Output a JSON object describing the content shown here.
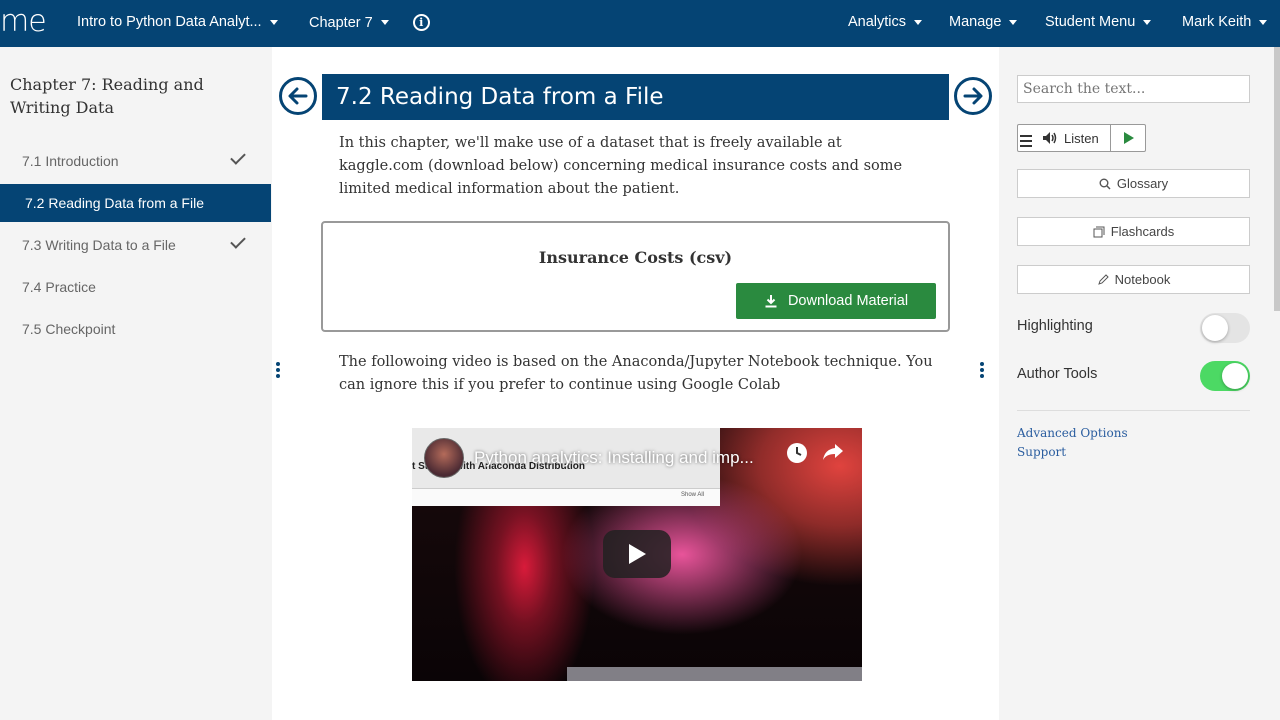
{
  "topbar": {
    "logo": "me",
    "course": "Intro to Python Data Analyt...",
    "chapter_menu": "Chapter 7",
    "analytics": "Analytics",
    "manage": "Manage",
    "student_menu": "Student Menu",
    "user": "Mark Keith"
  },
  "sidebar": {
    "chapter_title": "Chapter 7: Reading and Writing Data",
    "items": [
      {
        "label": "7.1 Introduction",
        "completed": true
      },
      {
        "label": "7.2 Reading Data from a File",
        "active": true
      },
      {
        "label": "7.3 Writing Data to a File",
        "completed": true
      },
      {
        "label": "7.4 Practice"
      },
      {
        "label": "7.5 Checkpoint"
      }
    ]
  },
  "main": {
    "section_title": "7.2  Reading Data from a File",
    "intro_text": "In this chapter, we'll make use of a dataset that is freely available at kaggle.com (download below) concerning medical insurance costs and some limited medical information about the patient.",
    "material_title": "Insurance Costs (csv)",
    "download_label": "Download Material",
    "video_note": "The followoing video is based on the Anaconda/Jupyter Notebook technique. You can ignore this if you prefer to continue using Google Colab",
    "video": {
      "title": "Python analytics: Installing and imp...",
      "subtitle": "t Started with Anaconda Distribution",
      "show_all": "Show All"
    }
  },
  "rightpanel": {
    "search_placeholder": "Search the text...",
    "listen_label": "Listen",
    "glossary_label": "Glossary",
    "flashcards_label": "Flashcards",
    "notebook_label": "Notebook",
    "highlighting_label": "Highlighting",
    "highlighting_on": false,
    "author_tools_label": "Author Tools",
    "author_tools_on": true,
    "advanced_options": "Advanced Options",
    "support": "Support"
  },
  "colors": {
    "brand": "#054474",
    "download_green": "#2a8a3f",
    "toggle_on": "#4cd964",
    "link": "#2a5d9f"
  }
}
